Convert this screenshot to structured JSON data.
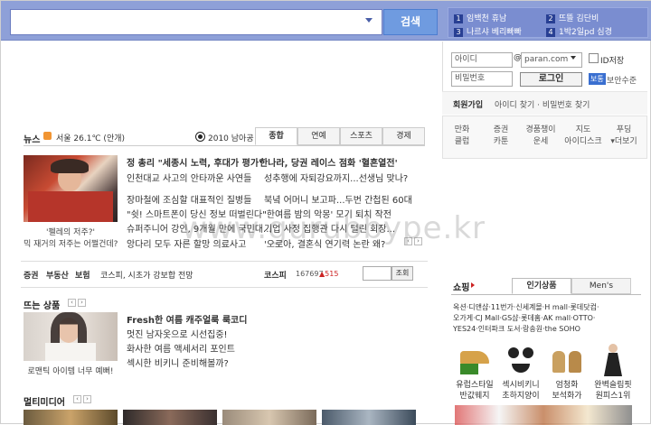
{
  "search": {
    "button": "검색"
  },
  "ranking": [
    {
      "num": "1",
      "text": "임백천 휴남"
    },
    {
      "num": "2",
      "text": "뜨뜰 김단비"
    },
    {
      "num": "3",
      "text": "나르샤 베리빠빠"
    },
    {
      "num": "4",
      "text": "1박2일pd 심경"
    }
  ],
  "login": {
    "id_value": "아이디",
    "at": "@",
    "domain": "paran.com",
    "save_id": "ID저장",
    "pw_value": "비밀번호",
    "login_button": "로그인",
    "security_badge": "보통",
    "security_text": "보안수준",
    "join": "회원가입",
    "find": "아이디 찾기 · 비밀번호 찾기"
  },
  "quick_menu": [
    {
      "l1": "만화",
      "l2": "클럽"
    },
    {
      "l1": "증권",
      "l2": "카툰"
    },
    {
      "l1": "경품챙이",
      "l2": "운세"
    },
    {
      "l1": "지도",
      "l2": "아이디스크"
    },
    {
      "l1": "푸딩",
      "l2": "▾더보기"
    }
  ],
  "news": {
    "label": "뉴스",
    "weather": "서울 26.1℃ (안개)",
    "worldcup": "2010 남아공",
    "tabs": [
      "종합",
      "연예",
      "스포츠",
      "경제"
    ],
    "headline1": "정 총리 \"세종시 노력, 후대가 평가\"",
    "headline2": "한나라, 당권 레이스 점화 '혈흔열전'",
    "lines": [
      "인천대교 사고의 안타까운 사연들",
      "성추행에 자퇴강요까지...선생님 맞나?",
      "장마철에 조심할 대표적인 질병들",
      "북녘 어머니 보고파...두번 간첩된 60대",
      "\"쉿! 스마트폰이 당신 정보 떠벌린다\"",
      "'한여름 밤의 악몽' 모기 퇴치 작전",
      "슈퍼주니어 강인, 9개월 만에 국민대...",
      "기업 사정 집행관 다시 털린 회장...",
      "앙다리 모두 자른 할망 의료사고",
      "'오로아, 결혼식 연기력 논란 왜?"
    ],
    "img_caption1": "'펠레의 저주?'",
    "img_caption2": "믹 재거의 저주는 어쩔건데?"
  },
  "stock": {
    "links": [
      "증권",
      "부동산",
      "보험"
    ],
    "headline": "코스피, 시초가 강보합 전망",
    "index_name": "코스피",
    "index_value": "167697",
    "change": "▲515",
    "search_btn": "조회"
  },
  "hot": {
    "label": "뜨는 상품",
    "items": [
      "Fresh한 여름 캐주얼룩 룩코디",
      "멋진 남자옷으로 시선집중!",
      "화사한 여름 액세서리 포인트",
      "섹시한 비키니 준비해볼까?"
    ],
    "caption": "로맨틱 아이템 너무 예뻐!"
  },
  "multimedia": {
    "label": "멀티미디어"
  },
  "watermark": "www.gurubbype.kr",
  "shopping": {
    "label": "쇼핑",
    "tabs": [
      "인기상품",
      "Men's"
    ],
    "links": [
      "옥션·디앤샵·11번가·신세계몰·H mall·롯데닷컴·",
      "오가게·CJ Mall·GS샵·롯데홈·AK mall·OTTO·",
      "YES24·인터파크 도서·랑송원·the SOHO"
    ],
    "products": [
      {
        "l1": "유럽스타일",
        "l2": "반값웨지"
      },
      {
        "l1": "섹시비키니",
        "l2": "초하지양이"
      },
      {
        "l1": "엄청화",
        "l2": "보석화가"
      },
      {
        "l1": "완벽슬림핏",
        "l2": "원피스1위"
      }
    ]
  },
  "colors": {
    "topbar": "#8ea0d8",
    "search_button": "#6f9be0",
    "rank_num": "#283f93",
    "change_red": "#cc2222"
  }
}
